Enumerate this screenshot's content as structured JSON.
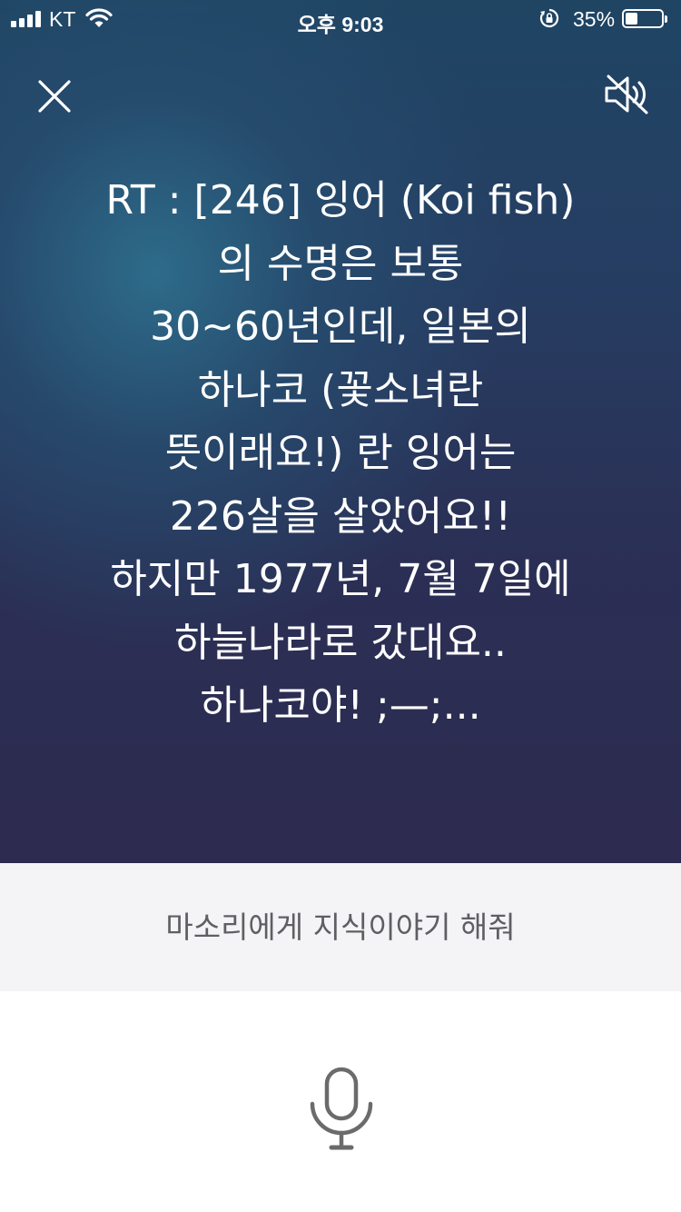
{
  "status_bar": {
    "carrier": "KT",
    "time": "오후 9:03",
    "battery_percent_text": "35%",
    "battery_level": 0.35,
    "signal_icon": "cellular-signal-icon",
    "wifi_icon": "wifi-icon",
    "rotation_lock_icon": "rotation-lock-icon",
    "battery_icon": "battery-icon"
  },
  "header": {
    "close_icon": "close-icon",
    "mute_icon": "speaker-muted-icon"
  },
  "message": {
    "text": "RT : [246] 잉어 (Koi fish)\n의 수명은 보통\n30~60년인데, 일본의\n하나코 (꽃소녀란\n뜻이래요!) 란 잉어는\n226살을 살았어요!!\n하지만 1977년, 7월 7일에\n하늘나라로 갔대요..\n하나코야! ;—;..."
  },
  "suggestion": {
    "text": "마소리에게 지식이야기 해줘"
  },
  "mic": {
    "icon": "microphone-icon"
  },
  "colors": {
    "top_gradient_start": "#1f4563",
    "top_gradient_end": "#2d2b4f",
    "suggestion_bg": "#f4f4f6",
    "suggestion_text": "#5f5f63",
    "mic_icon": "#6b6b6b"
  }
}
